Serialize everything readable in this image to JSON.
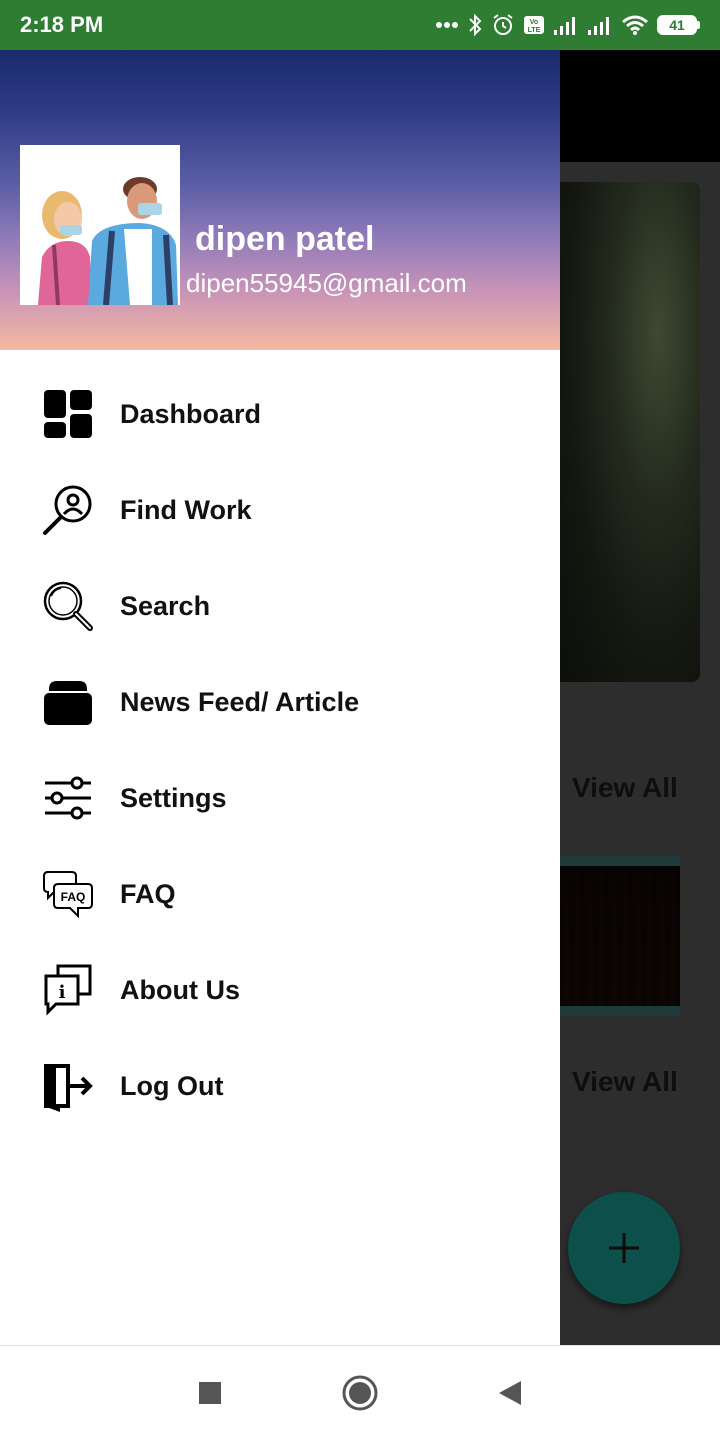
{
  "status_bar": {
    "time": "2:18 PM",
    "battery": "41",
    "icons": [
      "more-dots-icon",
      "bluetooth-icon",
      "alarm-icon",
      "volte-icon",
      "signal-icon",
      "signal-icon",
      "wifi-icon",
      "battery-icon"
    ]
  },
  "drawer": {
    "user_name": "dipen patel",
    "user_email": "dipen55945@gmail.com",
    "items": [
      {
        "label": "Dashboard",
        "icon": "dashboard-icon"
      },
      {
        "label": "Find Work",
        "icon": "find-work-icon"
      },
      {
        "label": "Search",
        "icon": "search-icon"
      },
      {
        "label": "News Feed/ Article",
        "icon": "news-feed-icon"
      },
      {
        "label": "Settings",
        "icon": "settings-sliders-icon"
      },
      {
        "label": "FAQ",
        "icon": "faq-icon"
      },
      {
        "label": "About Us",
        "icon": "about-us-icon"
      },
      {
        "label": "Log Out",
        "icon": "logout-icon"
      }
    ]
  },
  "background": {
    "view_all_1": "View All",
    "view_all_2": "View All",
    "fab_icon": "plus-icon"
  },
  "colors": {
    "status_bar": "#2e7d32",
    "fab": "#0d4f4a",
    "header_top": "#1a2a6c",
    "header_bottom": "#f5b8a2"
  },
  "nav_bar": {
    "buttons": [
      "recents-icon",
      "home-icon",
      "back-icon"
    ]
  }
}
